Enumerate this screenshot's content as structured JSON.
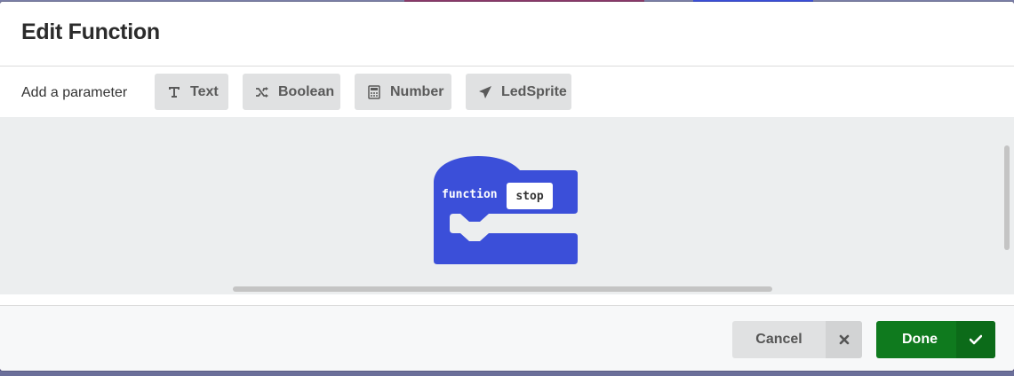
{
  "dialog": {
    "title": "Edit Function"
  },
  "parameters": {
    "label": "Add a parameter",
    "buttons": [
      {
        "label": "Text",
        "icon": "text-cursor-icon"
      },
      {
        "label": "Boolean",
        "icon": "shuffle-icon"
      },
      {
        "label": "Number",
        "icon": "calculator-icon"
      },
      {
        "label": "LedSprite",
        "icon": "paper-plane-icon"
      }
    ]
  },
  "workspace": {
    "block": {
      "keyword": "function",
      "name": "stop",
      "color": "#3b4fd9"
    }
  },
  "footer": {
    "cancel_label": "Cancel",
    "done_label": "Done"
  },
  "colors": {
    "done_green": "#0f7a1e",
    "block_blue": "#3b4fd9"
  }
}
